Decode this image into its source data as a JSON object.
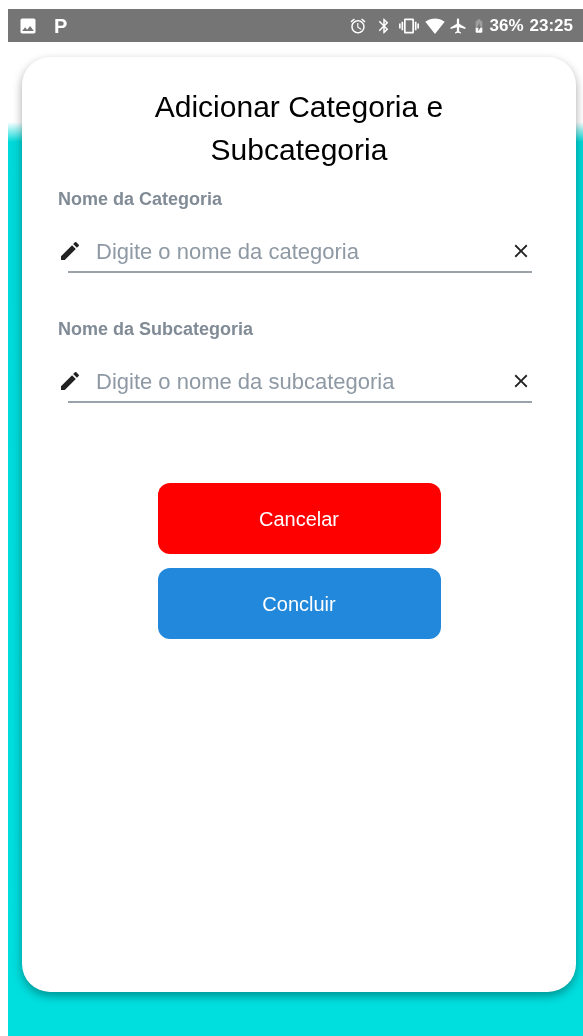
{
  "status_bar": {
    "app_letter": "P",
    "battery": "36%",
    "time": "23:25"
  },
  "dialog": {
    "title": "Adicionar Categoria e Subcategoria",
    "fields": [
      {
        "label": "Nome da Categoria",
        "placeholder": "Digite o nome da categoria"
      },
      {
        "label": "Nome da Subcategoria",
        "placeholder": "Digite o nome da subcategoria"
      }
    ],
    "buttons": [
      {
        "label": "Cancelar",
        "kind": "cancel"
      },
      {
        "label": "Concluir",
        "kind": "confirm"
      }
    ]
  }
}
